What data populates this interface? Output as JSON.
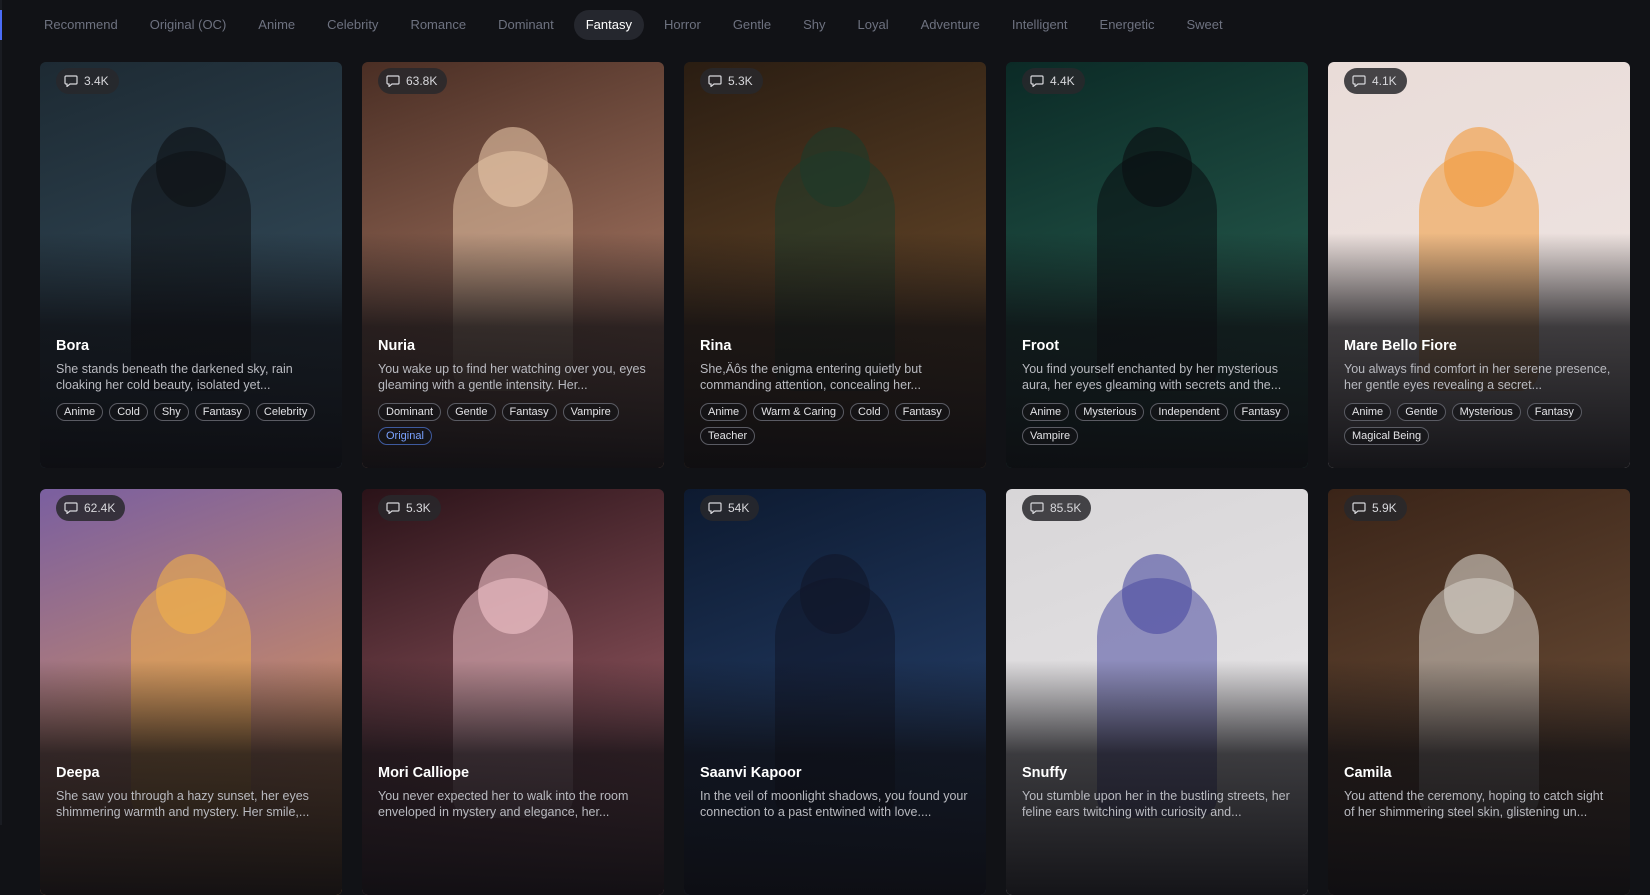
{
  "tabs": [
    {
      "label": "Recommend",
      "active": false
    },
    {
      "label": "Original (OC)",
      "active": false
    },
    {
      "label": "Anime",
      "active": false
    },
    {
      "label": "Celebrity",
      "active": false
    },
    {
      "label": "Romance",
      "active": false
    },
    {
      "label": "Dominant",
      "active": false
    },
    {
      "label": "Fantasy",
      "active": true
    },
    {
      "label": "Horror",
      "active": false
    },
    {
      "label": "Gentle",
      "active": false
    },
    {
      "label": "Shy",
      "active": false
    },
    {
      "label": "Loyal",
      "active": false
    },
    {
      "label": "Adventure",
      "active": false
    },
    {
      "label": "Intelligent",
      "active": false
    },
    {
      "label": "Energetic",
      "active": false
    },
    {
      "label": "Sweet",
      "active": false
    }
  ],
  "cards": [
    {
      "count": "3.4K",
      "name": "Bora",
      "desc": "She stands beneath the darkened sky, rain cloaking her cold beauty, isolated yet...",
      "tags": [
        "Anime",
        "Cold",
        "Shy",
        "Fantasy",
        "Celebrity"
      ],
      "original": "",
      "bg": [
        "#1d2a33",
        "#3a5566"
      ],
      "fig": "#0e1114"
    },
    {
      "count": "63.8K",
      "name": "Nuria",
      "desc": "You wake up to find her watching over you, eyes gleaming with a gentle intensity. Her...",
      "tags": [
        "Dominant",
        "Gentle",
        "Fantasy",
        "Vampire"
      ],
      "original": "Original",
      "bg": [
        "#4a2e24",
        "#c58f78"
      ],
      "fig": "#e8c6a8"
    },
    {
      "count": "5.3K",
      "name": "Rina",
      "desc": "She,Äôs the enigma entering quietly but commanding attention, concealing her...",
      "tags": [
        "Anime",
        "Warm & Caring",
        "Cold",
        "Fantasy",
        "Teacher"
      ],
      "original": "",
      "bg": [
        "#2a1d12",
        "#7a5530"
      ],
      "fig": "#1d3a2a"
    },
    {
      "count": "4.4K",
      "name": "Froot",
      "desc": "You find yourself enchanted by her mysterious aura, her eyes gleaming with secrets and the...",
      "tags": [
        "Anime",
        "Mysterious",
        "Independent",
        "Fantasy",
        "Vampire"
      ],
      "original": "",
      "bg": [
        "#0b2a26",
        "#2f6b5a"
      ],
      "fig": "#0a0d10"
    },
    {
      "count": "4.1K",
      "name": "Mare Bello Fiore",
      "desc": "You always find comfort in her serene presence, her gentle eyes revealing a secret...",
      "tags": [
        "Anime",
        "Gentle",
        "Mysterious",
        "Fantasy",
        "Magical Being"
      ],
      "original": "",
      "bg": [
        "#e9dcd8",
        "#f0e6e4"
      ],
      "fig": "#f29a3a"
    },
    {
      "count": "62.4K",
      "name": "Deepa",
      "desc": "She saw you through a hazy sunset, her eyes shimmering warmth and mystery. Her smile,...",
      "tags": [],
      "original": "",
      "bg": [
        "#7a5fa0",
        "#f0a04a"
      ],
      "fig": "#f2b04a"
    },
    {
      "count": "5.3K",
      "name": "Mori Calliope",
      "desc": "You never expected her to walk into the room enveloped in mystery and elegance, her...",
      "tags": [],
      "original": "",
      "bg": [
        "#2a1218",
        "#b8707a"
      ],
      "fig": "#f3c4cc"
    },
    {
      "count": "54K",
      "name": "Saanvi Kapoor",
      "desc": "In the veil of moonlight shadows, you found your connection to a past entwined with love....",
      "tags": [],
      "original": "",
      "bg": [
        "#0d1a30",
        "#2c4a7a"
      ],
      "fig": "#101628"
    },
    {
      "count": "85.5K",
      "name": "Snuffy",
      "desc": "You stumble upon her in the bustling streets, her feline ears twitching with curiosity and...",
      "tags": [],
      "original": "",
      "bg": [
        "#d8d6d8",
        "#eae8ea"
      ],
      "fig": "#4a4aa0"
    },
    {
      "count": "5.9K",
      "name": "Camila",
      "desc": "You attend the ceremony, hoping to catch sight of her shimmering steel skin, glistening un...",
      "tags": [],
      "original": "",
      "bg": [
        "#3a2418",
        "#7a5a40"
      ],
      "fig": "#d8d4cc"
    }
  ]
}
